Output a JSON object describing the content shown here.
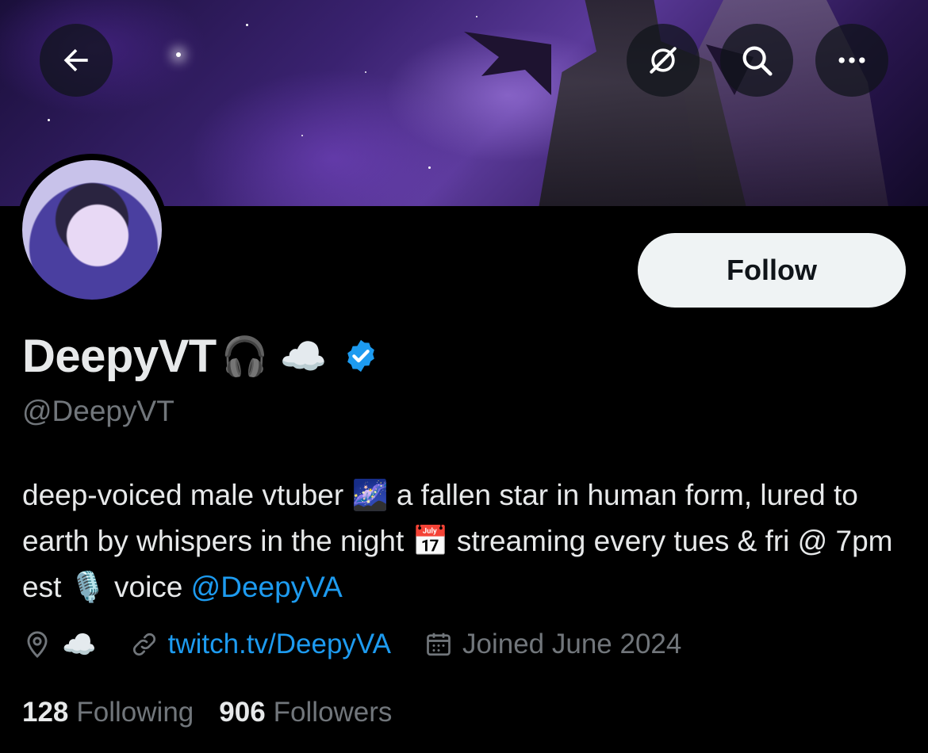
{
  "header": {
    "back_icon": "arrow-left-icon",
    "grok_icon": "grok-slash-icon",
    "search_icon": "search-icon",
    "more_icon": "more-horizontal-icon"
  },
  "profile": {
    "display_name": "DeepyVT",
    "name_emojis": [
      "🎧",
      "☁️"
    ],
    "handle": "@DeepyVT",
    "follow_label": "Follow",
    "bio": {
      "part1": "deep-voiced male vtuber",
      "emoji1": "🌌",
      "part2": "a fallen star in human form, lured to earth by whispers in the night",
      "emoji2": "📅",
      "part3": "streaming every tues & fri @ 7pm est",
      "emoji3": "🎙️",
      "part4": "voice",
      "mention": "@DeepyVA"
    },
    "location": "☁️",
    "website": "twitch.tv/DeepyVA",
    "joined": "Joined June 2024"
  },
  "stats": {
    "following_count": "128",
    "following_label": "Following",
    "followers_count": "906",
    "followers_label": "Followers"
  },
  "colors": {
    "link": "#1d9bf0",
    "verified": "#1d9bf0",
    "muted": "#71767b",
    "text": "#e7e9ea"
  }
}
